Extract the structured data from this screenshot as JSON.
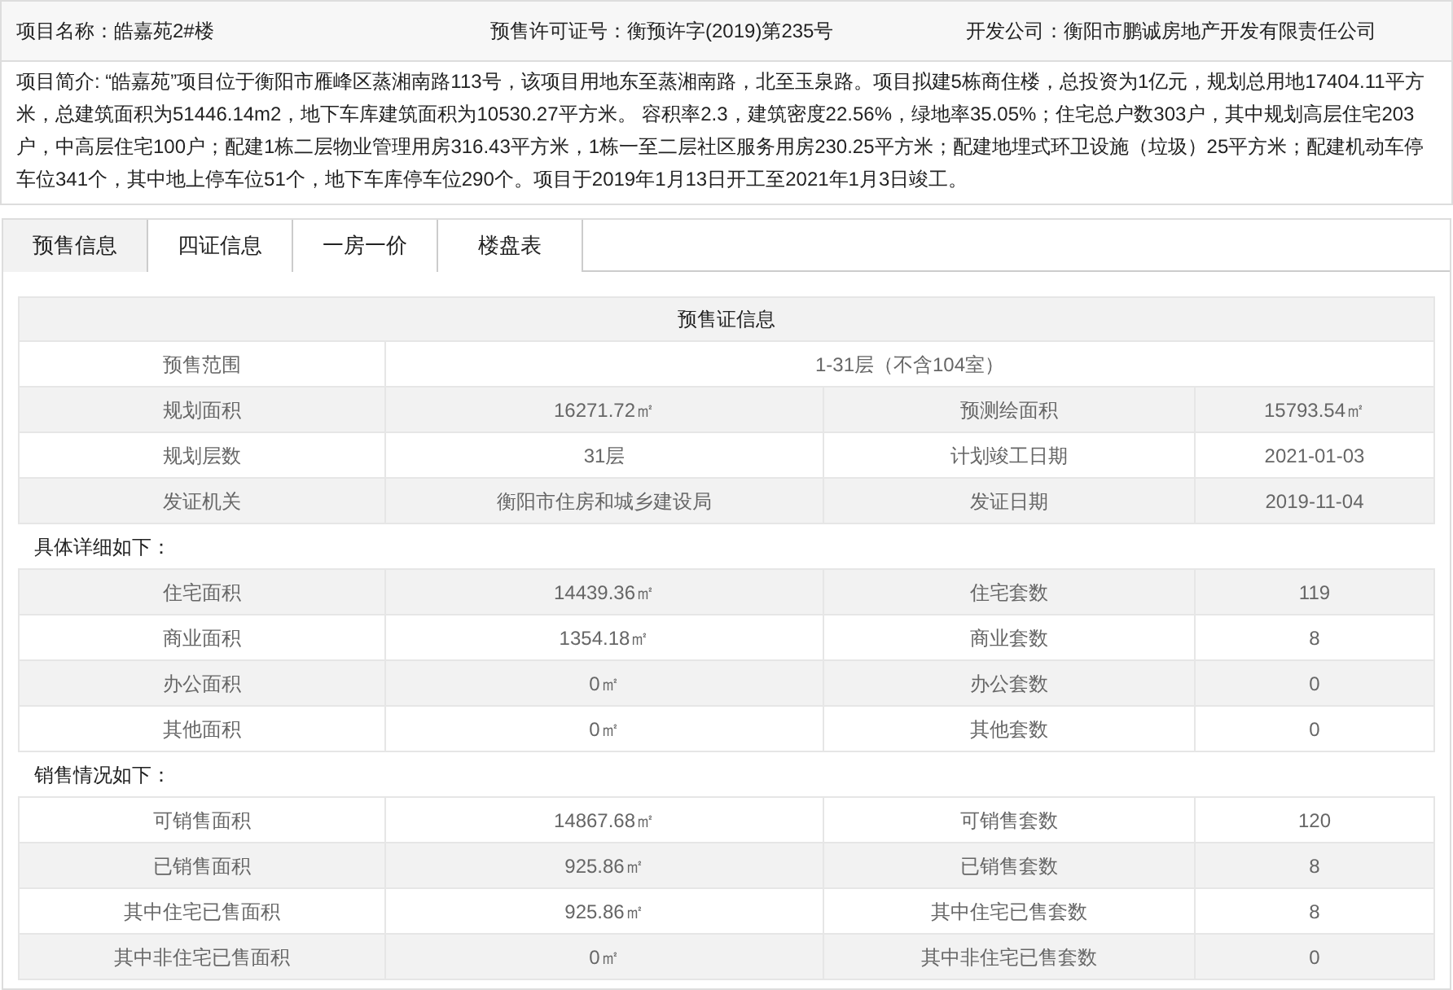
{
  "header": [
    "项目名称：皓嘉苑2#楼",
    "预售许可证号：衡预许字(2019)第235号",
    "开发公司：衡阳市鹏诚房地产开发有限责任公司"
  ],
  "intro": "项目简介: “皓嘉苑”项目位于衡阳市雁峰区蒸湘南路113号，该项目用地东至蒸湘南路，北至玉泉路。项目拟建5栋商住楼，总投资为1亿元，规划总用地17404.11平方米，总建筑面积为51446.14m2，地下车库建筑面积为10530.27平方米。 容积率2.3，建筑密度22.56%，绿地率35.05%；住宅总户数303户，其中规划高层住宅203户，中高层住宅100户；配建1栋二层物业管理用房316.43平方米，1栋一至二层社区服务用房230.25平方米；配建地埋式环卫设施（垃圾）25平方米；配建机动车停车位341个，其中地上停车位51个，地下车库停车位290个。项目于2019年1月13日开工至2021年1月3日竣工。",
  "tabs": [
    {
      "label": "预售信息",
      "selected": true
    },
    {
      "label": "四证信息",
      "selected": false
    },
    {
      "label": "一房一价",
      "selected": false
    },
    {
      "label": "楼盘表",
      "selected": false
    }
  ],
  "table": {
    "title": "预售证信息",
    "rows": [
      {
        "kind": "span",
        "cells": [
          "预售范围",
          "1-31层（不含104室）"
        ]
      },
      {
        "kind": "pair",
        "cells": [
          "规划面积",
          "16271.72㎡",
          "预测绘面积",
          "15793.54㎡"
        ]
      },
      {
        "kind": "pair",
        "cells": [
          "规划层数",
          "31层",
          "计划竣工日期",
          "2021-01-03"
        ]
      },
      {
        "kind": "pair",
        "cells": [
          "发证机关",
          "衡阳市住房和城乡建设局",
          "发证日期",
          "2019-11-04"
        ]
      },
      {
        "kind": "section",
        "cells": [
          "具体详细如下："
        ]
      },
      {
        "kind": "pair",
        "cells": [
          "住宅面积",
          "14439.36㎡",
          "住宅套数",
          "119"
        ]
      },
      {
        "kind": "pair",
        "cells": [
          "商业面积",
          "1354.18㎡",
          "商业套数",
          "8"
        ]
      },
      {
        "kind": "pair",
        "cells": [
          "办公面积",
          "0㎡",
          "办公套数",
          "0"
        ]
      },
      {
        "kind": "pair",
        "cells": [
          "其他面积",
          "0㎡",
          "其他套数",
          "0"
        ]
      },
      {
        "kind": "section",
        "cells": [
          "销售情况如下："
        ]
      },
      {
        "kind": "pair",
        "cells": [
          "可销售面积",
          "14867.68㎡",
          "可销售套数",
          "120"
        ]
      },
      {
        "kind": "pair",
        "cells": [
          "已销售面积",
          "925.86㎡",
          "已销售套数",
          "8"
        ]
      },
      {
        "kind": "pair",
        "cells": [
          "其中住宅已售面积",
          "925.86㎡",
          "其中住宅已售套数",
          "8"
        ]
      },
      {
        "kind": "pair",
        "cells": [
          "其中非住宅已售面积",
          "0㎡",
          "其中非住宅已售套数",
          "0"
        ]
      }
    ]
  }
}
